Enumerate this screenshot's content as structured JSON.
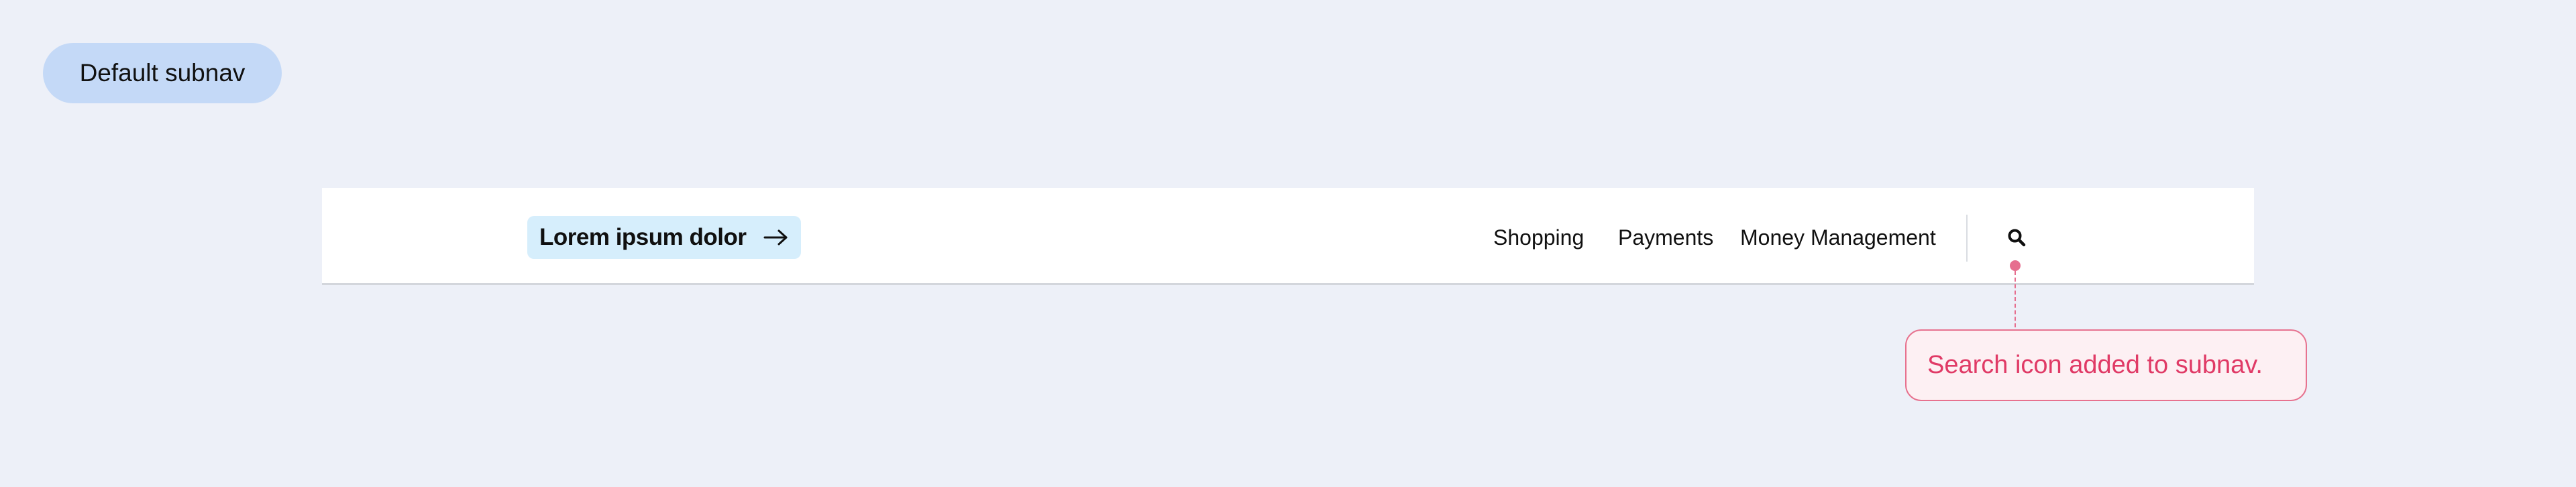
{
  "label_pill": {
    "text": "Default subnav"
  },
  "subnav": {
    "brand": {
      "label": "Lorem ipsum dolor",
      "icon": "arrow-right-icon"
    },
    "nav_items": [
      {
        "label": "Shopping"
      },
      {
        "label": "Payments"
      },
      {
        "label": "Money Management"
      }
    ],
    "search": {
      "icon": "search-icon"
    }
  },
  "annotation": {
    "text": "Search icon added to subnav."
  },
  "colors": {
    "background": "#edf0f8",
    "pill_bg": "#c4d9f7",
    "brand_bg": "#d6eefc",
    "annotation_accent": "#e03a66",
    "annotation_bg": "#fdf0f3"
  }
}
